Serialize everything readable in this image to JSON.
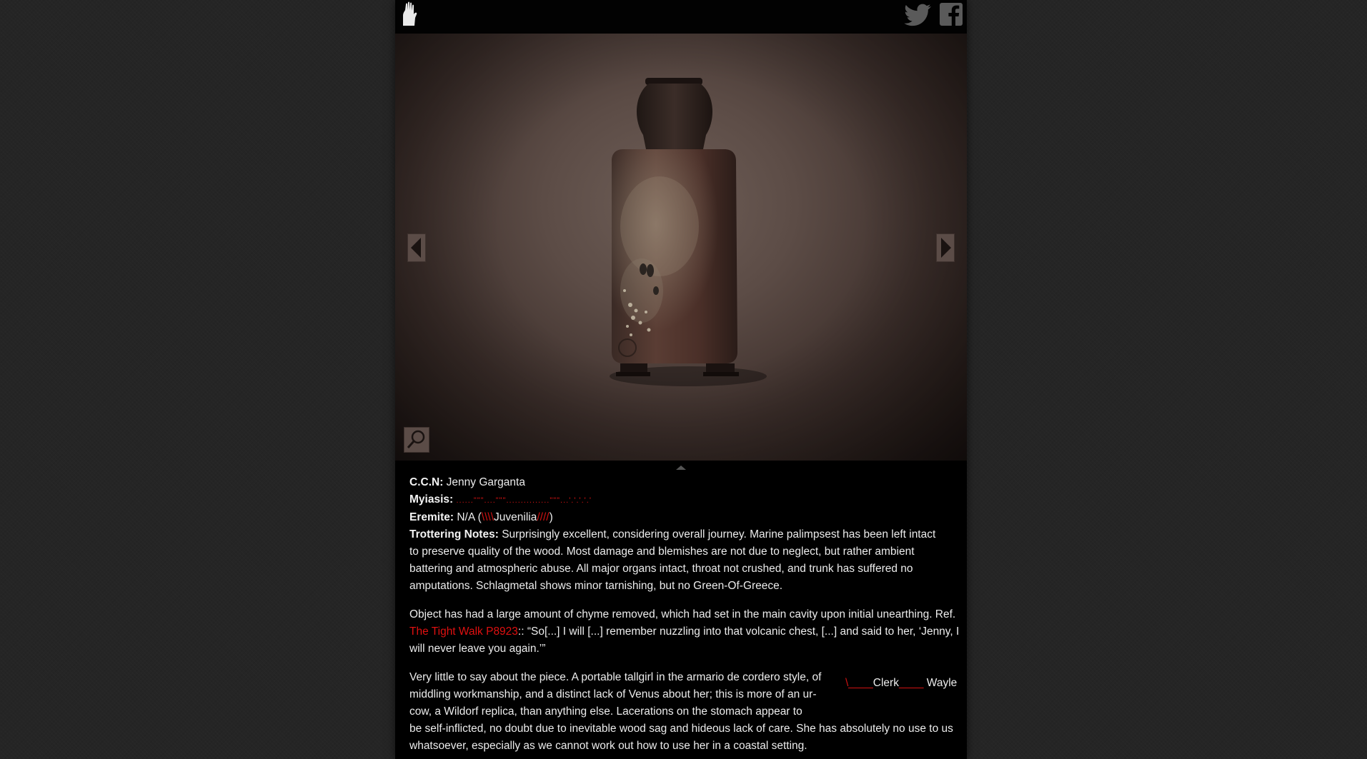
{
  "header": {
    "logo_icon": "hand-icon",
    "twitter_icon": "twitter-icon",
    "facebook_icon": "facebook-icon"
  },
  "viewer": {
    "prev_icon": "arrow-left-icon",
    "next_icon": "arrow-right-icon",
    "zoom_icon": "magnifier-icon",
    "collapse_icon": "chevron-up-icon"
  },
  "fields": {
    "ccn_label": "C.C.N:",
    "ccn_value": "Jenny Garganta",
    "myiasis_label": "Myiasis:",
    "myiasis_value": "......\"\"\"....\"\"\"...............\"\"\"...'.'.'.'.'",
    "eremite_label": "Eremite:",
    "eremite_value_prefix": "N/A (",
    "eremite_red_left": "\\\\\\\\",
    "eremite_mid": "Juvenilia",
    "eremite_red_right": "////",
    "eremite_value_suffix": ")",
    "trottering_label": "Trottering Notes:",
    "trottering_value": "Surprisingly excellent, considering overall journey. Marine palimpsest has been left intact to preserve quality of the wood. Most damage and blemishes are not due to neglect, but rather ambient battering and atmospheric abuse. All major organs intact, throat not crushed, and trunk has suffered no amputations. Schlagmetal shows minor tarnishing, but no Green-Of-Greece."
  },
  "paragraph2": {
    "intro": "Object has had a large amount of chyme removed, which had set in the main cavity upon initial unearthing. Ref.",
    "link": "The Tight Walk P8923",
    "rest": ":: “So[...] I will [...] remember nuzzling into that volcanic chest, [...] and said to her, ‘Jenny, I will never leave you again.’”"
  },
  "paragraph3": {
    "wrapped": "Very little to say about the piece. A portable tallgirl in the armario de cordero style, of middling workmanship, and a distinct lack of Venus about her; this is more of an ur-cow, a Wildorf replica, than anything else. Lacerations on the stomach appear to",
    "continued": "be self-inflicted, no doubt due to inevitable wood sag and hideous lack of care. She has absolutely no use to us whatsoever, especially as we cannot work out how to use her in a coastal setting."
  },
  "sidenote": {
    "red_prefix": "\\____",
    "clerk": "Clerk",
    "red_mid": "____",
    "name": "Wayle"
  }
}
